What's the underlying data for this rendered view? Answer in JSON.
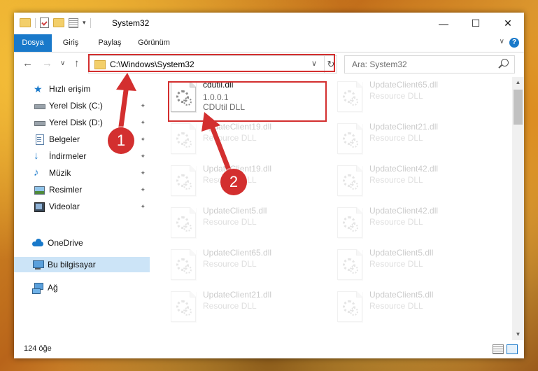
{
  "window": {
    "title": "System32",
    "controls": {
      "minimize": "—",
      "maximize": "☐",
      "close": "✕"
    }
  },
  "ribbon": {
    "tabs": [
      "Dosya",
      "Giriş",
      "Paylaş",
      "Görünüm"
    ],
    "active_tab": "Dosya",
    "help": "?",
    "collapse": "∨"
  },
  "nav": {
    "back": "←",
    "forward": "→",
    "recent": "∨",
    "up": "↑",
    "address": "C:\\Windows\\System32",
    "address_dropdown": "∨",
    "refresh": "↻",
    "search_placeholder": "Ara: System32"
  },
  "sidebar": {
    "items": [
      {
        "label": "Hızlı erişim",
        "icon": "star-icon",
        "pinned": false
      },
      {
        "label": "Yerel Disk (C:)",
        "icon": "drive-icon",
        "pinned": true
      },
      {
        "label": "Yerel Disk (D:)",
        "icon": "drive-icon",
        "pinned": true
      },
      {
        "label": "Belgeler",
        "icon": "documents-icon",
        "pinned": true
      },
      {
        "label": "İndirmeler",
        "icon": "download-icon",
        "pinned": true
      },
      {
        "label": "Müzik",
        "icon": "music-icon",
        "pinned": true
      },
      {
        "label": "Resimler",
        "icon": "pictures-icon",
        "pinned": true
      },
      {
        "label": "Videolar",
        "icon": "videos-icon",
        "pinned": true
      },
      {
        "label": "OneDrive",
        "icon": "cloud-icon",
        "pinned": false
      },
      {
        "label": "Bu bilgisayar",
        "icon": "computer-icon",
        "pinned": false,
        "selected": true
      },
      {
        "label": "Ağ",
        "icon": "network-icon",
        "pinned": false
      }
    ],
    "pin_glyph": "📌"
  },
  "files": [
    {
      "name": "cdutil.dll",
      "version": "1.0.0.1",
      "desc": "CDUtil DLL",
      "highlighted": true
    },
    {
      "name": "UpdateClient65.dll",
      "desc": "Resource DLL"
    },
    {
      "name": "UpdateClient19.dll",
      "desc": "Resource DLL"
    },
    {
      "name": "UpdateClient21.dll",
      "desc": "Resource DLL"
    },
    {
      "name": "UpdateClient19.dll",
      "desc": "Resource DLL"
    },
    {
      "name": "UpdateClient42.dll",
      "desc": "Resource DLL"
    },
    {
      "name": "UpdateClient5.dll",
      "desc": "Resource DLL"
    },
    {
      "name": "UpdateClient42.dll",
      "desc": "Resource DLL"
    },
    {
      "name": "UpdateClient65.dll",
      "desc": "Resource DLL"
    },
    {
      "name": "UpdateClient5.dll",
      "desc": "Resource DLL"
    },
    {
      "name": "UpdateClient21.dll",
      "desc": "Resource DLL"
    },
    {
      "name": "UpdateClient5.dll",
      "desc": "Resource DLL"
    }
  ],
  "status": {
    "item_count": "124 öğe"
  },
  "callouts": [
    "1",
    "2"
  ],
  "colors": {
    "accent": "#1979ca",
    "highlight": "#d32f2f",
    "selected_bg": "#cce4f7"
  }
}
